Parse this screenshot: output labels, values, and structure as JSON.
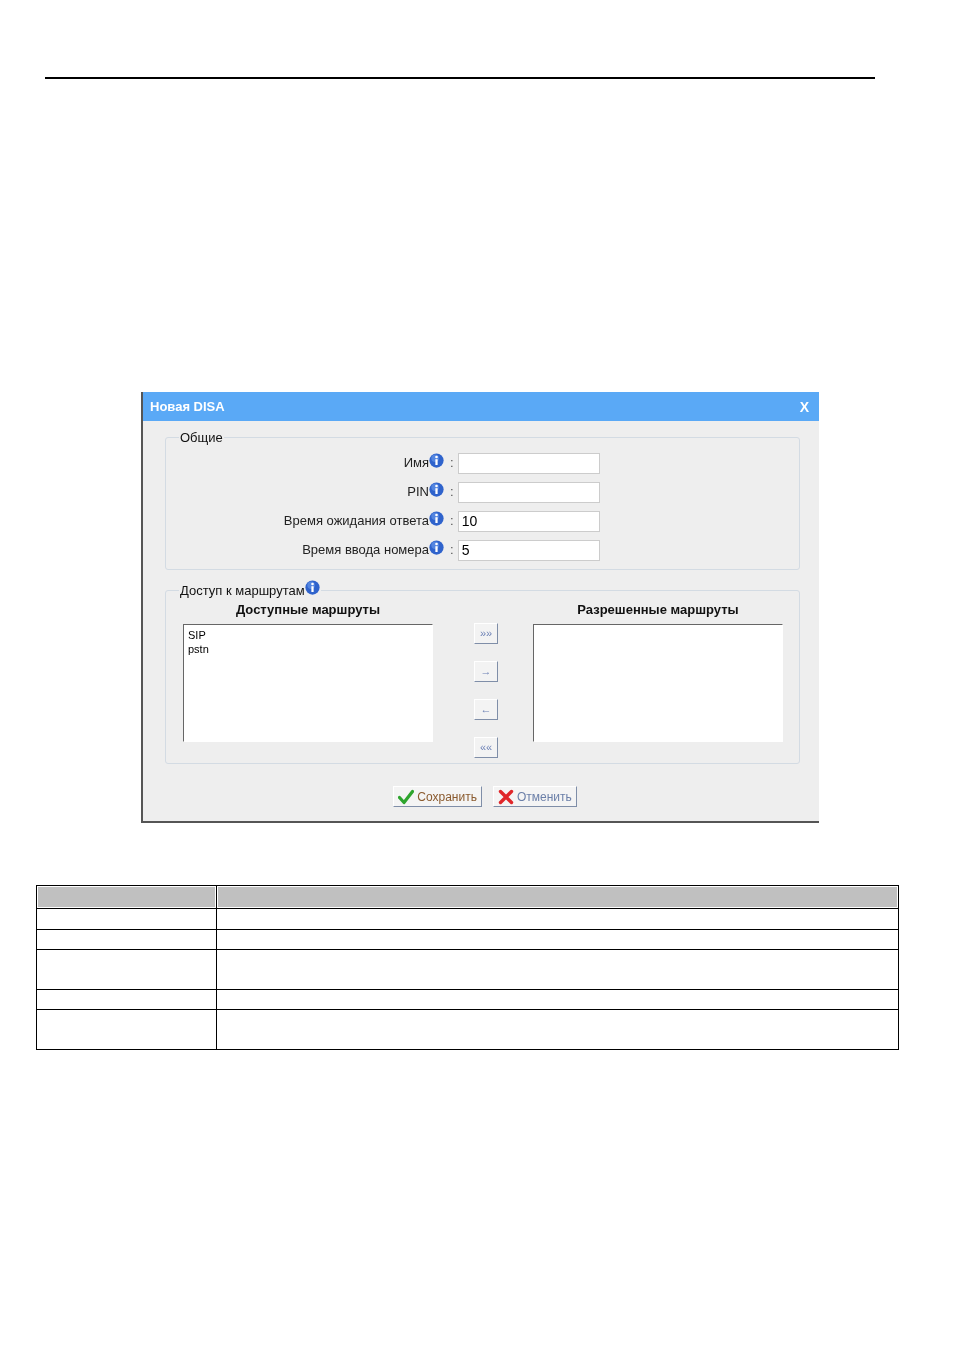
{
  "dialog": {
    "title": "Новая DISA",
    "close_label": "X"
  },
  "general": {
    "legend": "Общие",
    "fields": [
      {
        "label": "Имя",
        "colon": ":"
      },
      {
        "label": "PIN",
        "colon": ":"
      },
      {
        "label": "Время ожидания ответа",
        "colon": ":",
        "value": "10"
      },
      {
        "label": "Время ввода номера",
        "colon": ":",
        "value": "5"
      }
    ]
  },
  "routes": {
    "legend": "Доступ к маршрутам",
    "available": {
      "heading": "Доступные маршруты",
      "items": [
        {
          "label": "SIP",
          "selected": false
        },
        {
          "label": "pstn",
          "selected": false
        }
      ]
    },
    "allowed": {
      "heading": "Разрешенные маршруты"
    },
    "move_buttons": [
      "»»",
      "→",
      "←",
      "««"
    ]
  },
  "actions": [
    {
      "kind": "save",
      "label": "Сохранить"
    },
    {
      "kind": "cancel",
      "label": "Отменить"
    }
  ]
}
